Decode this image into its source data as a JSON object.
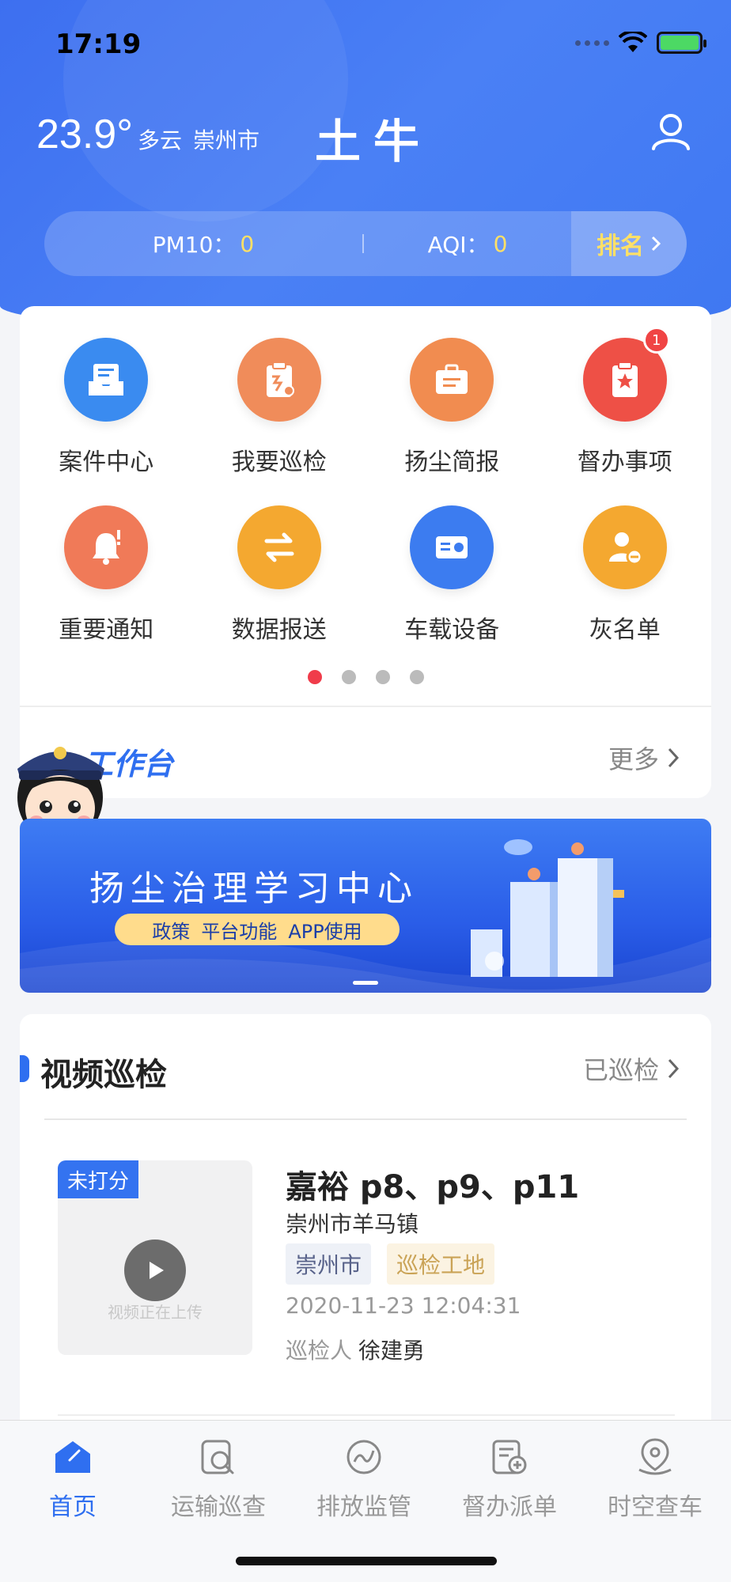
{
  "status_bar": {
    "time": "17:19"
  },
  "header": {
    "temperature": "23.9°",
    "weather": "多云",
    "city": "崇州市",
    "app_title": "土牛"
  },
  "air_quality": {
    "pm10_label": "PM10：",
    "pm10_value": "0",
    "aqi_label": "AQI：",
    "aqi_value": "0",
    "rank_label": "排名"
  },
  "grid_menu": {
    "items": [
      {
        "label": "案件中心",
        "icon": "inbox-icon",
        "color": "#3a8bf0"
      },
      {
        "label": "我要巡检",
        "icon": "clipboard-patrol-icon",
        "color": "#f08c5a"
      },
      {
        "label": "扬尘简报",
        "icon": "briefcase-report-icon",
        "color": "#f18c50"
      },
      {
        "label": "督办事项",
        "icon": "clipboard-star-icon",
        "color": "#ee5046",
        "badge": "1"
      },
      {
        "label": "重要通知",
        "icon": "bell-alert-icon",
        "color": "#f07a58"
      },
      {
        "label": "数据报送",
        "icon": "swap-arrows-icon",
        "color": "#f4a830"
      },
      {
        "label": "车载设备",
        "icon": "device-card-icon",
        "color": "#3c7cf0"
      },
      {
        "label": "灰名单",
        "icon": "user-minus-icon",
        "color": "#f4a830"
      }
    ],
    "pages": 4,
    "active_page": 1
  },
  "workbench": {
    "title": "工作台",
    "more_label": "更多"
  },
  "banner": {
    "title": "扬尘治理学习中心",
    "pill": [
      "政策",
      "平台功能",
      "APP使用"
    ]
  },
  "video_patrol": {
    "title": "视频巡检",
    "more_label": "已巡检",
    "item": {
      "tag": "未打分",
      "thumb_text": "视频正在上传",
      "title": "嘉裕 p8、p9、p11",
      "address": "崇州市羊马镇",
      "tags": [
        "崇州市",
        "巡检工地"
      ],
      "time": "2020-11-23 12:04:31",
      "inspector_label": "巡检人",
      "inspector": "徐建勇"
    }
  },
  "tabbar": {
    "tabs": [
      {
        "label": "首页",
        "icon": "home-icon",
        "active": true
      },
      {
        "label": "运输巡查",
        "icon": "search-doc-icon",
        "active": false
      },
      {
        "label": "排放监管",
        "icon": "trend-circle-icon",
        "active": false
      },
      {
        "label": "督办派单",
        "icon": "doc-add-icon",
        "active": false
      },
      {
        "label": "时空查车",
        "icon": "location-pin-icon",
        "active": false
      }
    ]
  },
  "colors": {
    "primary": "#2f6ff0",
    "header_bg": "#4a80f5",
    "highlight": "#ffe066"
  }
}
